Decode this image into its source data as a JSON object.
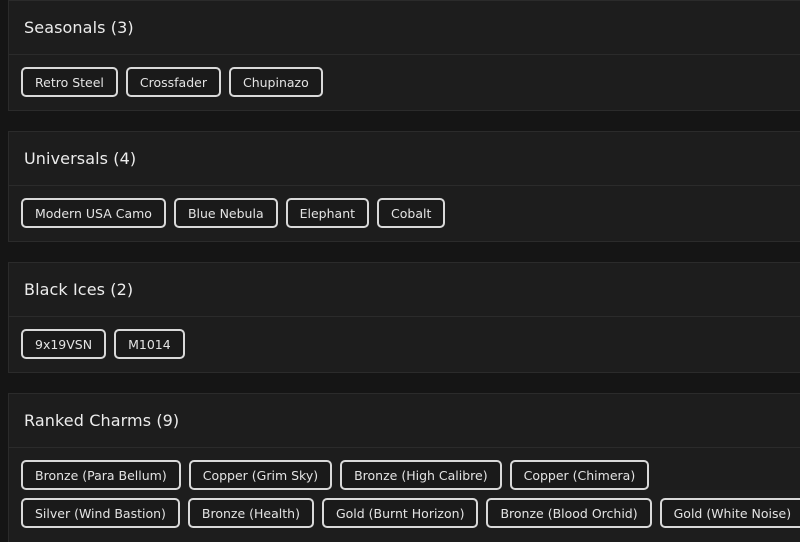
{
  "sections": [
    {
      "title": "Seasonals (3)",
      "items": [
        "Retro Steel",
        "Crossfader",
        "Chupinazo"
      ]
    },
    {
      "title": "Universals (4)",
      "items": [
        "Modern USA Camo",
        "Blue Nebula",
        "Elephant",
        "Cobalt"
      ]
    },
    {
      "title": "Black Ices (2)",
      "items": [
        "9x19VSN",
        "M1014"
      ]
    },
    {
      "title": "Ranked Charms (9)",
      "items": [
        "Bronze (Para Bellum)",
        "Copper (Grim Sky)",
        "Bronze (High Calibre)",
        "Copper (Chimera)",
        "Silver (Wind Bastion)",
        "Bronze (Health)",
        "Gold (Burnt Horizon)",
        "Bronze (Blood Orchid)",
        "Gold (White Noise)"
      ]
    }
  ]
}
